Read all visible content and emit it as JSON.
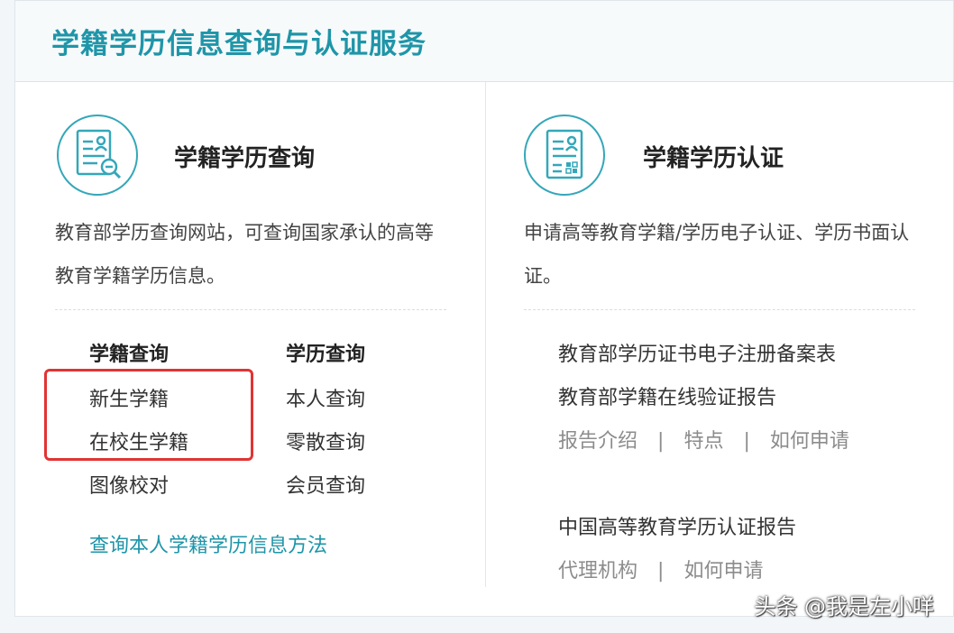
{
  "header": {
    "title": "学籍学历信息查询与认证服务"
  },
  "left_panel": {
    "icon": "document-search-icon",
    "title": "学籍学历查询",
    "description": "教育部学历查询网站，可查询国家承认的高等教育学籍学历信息。",
    "col1": {
      "heading": "学籍查询",
      "items": [
        "新生学籍",
        "在校生学籍",
        "图像校对"
      ]
    },
    "col2": {
      "heading": "学历查询",
      "items": [
        "本人查询",
        "零散查询",
        "会员查询"
      ]
    },
    "method_link": "查询本人学籍学历信息方法"
  },
  "right_panel": {
    "icon": "document-certificate-icon",
    "title": "学籍学历认证",
    "description": "申请高等教育学籍/学历电子认证、学历书面认证。",
    "report1": "教育部学历证书电子注册备案表",
    "report2": "教育部学籍在线验证报告",
    "links1": [
      "报告介绍",
      "特点",
      "如何申请"
    ],
    "report3": "中国高等教育学历认证报告",
    "links2": [
      "代理机构",
      "如何申请"
    ],
    "separator": "|"
  },
  "watermark": "头条 @我是左小咩",
  "colors": {
    "accent": "#1f95a8",
    "highlight": "#e23333"
  }
}
